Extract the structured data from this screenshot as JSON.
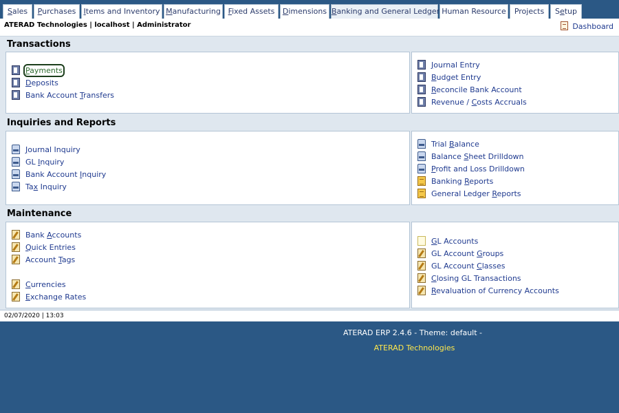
{
  "tabs": [
    {
      "label": "Sales",
      "u": "S",
      "rest": "ales"
    },
    {
      "label": "Purchases",
      "u": "P",
      "rest": "urchases"
    },
    {
      "label": "Items and Inventory",
      "u": "I",
      "rest": "tems and Inventory"
    },
    {
      "label": "Manufacturing",
      "u": "M",
      "rest": "anufacturing"
    },
    {
      "label": "Fixed Assets",
      "u": "F",
      "rest": "ixed Assets"
    },
    {
      "label": "Dimensions",
      "u": "D",
      "rest": "imensions"
    },
    {
      "label": "Banking and General Ledger",
      "u": "B",
      "rest": "anking and General Ledger"
    },
    {
      "label": "Human Resource",
      "u": "",
      "rest": "Human Resource"
    },
    {
      "label": "Projects",
      "u": "",
      "rest": "Projects"
    },
    {
      "label": "Setup",
      "pre": "S",
      "u": "e",
      "rest": "tup"
    }
  ],
  "header": {
    "company": "ATERAD Technologies | localhost | Administrator",
    "dashboard": "Dashboard"
  },
  "sections": {
    "transactions": "Transactions",
    "inquiries": "Inquiries and Reports",
    "maintenance": "Maintenance"
  },
  "transactions": {
    "left": [
      {
        "pre": "",
        "u": "P",
        "post": "ayments"
      },
      {
        "pre": "",
        "u": "D",
        "post": "eposits"
      },
      {
        "pre": "Bank Account ",
        "u": "T",
        "post": "ransfers"
      }
    ],
    "right": [
      {
        "pre": "",
        "u": "J",
        "post": "ournal Entry"
      },
      {
        "pre": "",
        "u": "B",
        "post": "udget Entry"
      },
      {
        "pre": "",
        "u": "R",
        "post": "econcile Bank Account"
      },
      {
        "pre": "Revenue / ",
        "u": "C",
        "post": "osts Accruals"
      }
    ]
  },
  "inquiries": {
    "left": [
      {
        "pre": "",
        "u": "J",
        "post": "ournal Inquiry"
      },
      {
        "pre": "GL ",
        "u": "I",
        "post": "nquiry"
      },
      {
        "pre": "Bank Account ",
        "u": "I",
        "post": "nquiry"
      },
      {
        "pre": "Ta",
        "u": "x",
        "post": " Inquiry"
      }
    ],
    "right": [
      {
        "pre": "Trial ",
        "u": "B",
        "post": "alance"
      },
      {
        "pre": "Balance ",
        "u": "S",
        "post": "heet Drilldown"
      },
      {
        "pre": "",
        "u": "P",
        "post": "rofit and Loss Drilldown"
      },
      {
        "pre": "Banking ",
        "u": "R",
        "post": "eports"
      },
      {
        "pre": "General Ledger ",
        "u": "R",
        "post": "eports"
      }
    ]
  },
  "maintenance": {
    "left": [
      {
        "pre": "Bank ",
        "u": "A",
        "post": "ccounts"
      },
      {
        "pre": "",
        "u": "Q",
        "post": "uick Entries"
      },
      {
        "pre": "Account ",
        "u": "T",
        "post": "ags"
      },
      {
        "pre": "",
        "u": "C",
        "post": "urrencies"
      },
      {
        "pre": "",
        "u": "E",
        "post": "xchange Rates"
      }
    ],
    "right": [
      {
        "pre": "",
        "u": "G",
        "post": "L Accounts"
      },
      {
        "pre": "GL Account ",
        "u": "G",
        "post": "roups"
      },
      {
        "pre": "GL Account ",
        "u": "C",
        "post": "lasses"
      },
      {
        "pre": "",
        "u": "C",
        "post": "losing GL Transactions"
      },
      {
        "pre": "",
        "u": "R",
        "post": "evaluation of Currency Accounts"
      }
    ]
  },
  "footer": {
    "datetime": "02/07/2020 | 13:03",
    "version": "ATERAD ERP 2.4.6 - Theme: default -",
    "company": "ATERAD Technologies"
  },
  "colors": {
    "background": "#2b5885",
    "link": "#1f3a8f",
    "footer_company": "#ffe84c"
  }
}
